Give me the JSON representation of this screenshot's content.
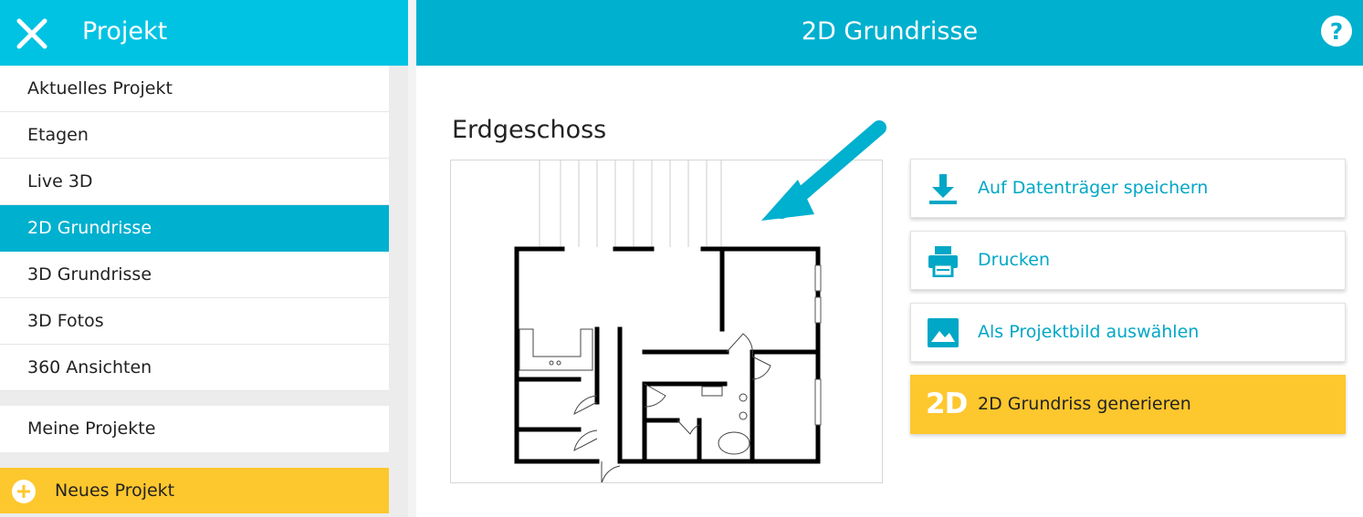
{
  "sidebar": {
    "title": "Projekt",
    "close_icon": "close-icon",
    "items": [
      {
        "label": "Aktuelles Projekt",
        "active": false
      },
      {
        "label": "Etagen",
        "active": false
      },
      {
        "label": "Live 3D",
        "active": false
      },
      {
        "label": "2D Grundrisse",
        "active": true
      },
      {
        "label": "3D Grundrisse",
        "active": false
      },
      {
        "label": "3D Fotos",
        "active": false
      },
      {
        "label": "360 Ansichten",
        "active": false
      }
    ],
    "my_projects": "Meine Projekte",
    "new_project": "Neues Projekt"
  },
  "header": {
    "title": "2D Grundrisse",
    "help_icon": "help-icon"
  },
  "main": {
    "floor_title": "Erdgeschoss",
    "actions": [
      {
        "label": "Auf Datenträger speichern",
        "icon": "download-icon"
      },
      {
        "label": "Drucken",
        "icon": "printer-icon"
      },
      {
        "label": "Als Projektbild auswählen",
        "icon": "image-icon"
      },
      {
        "label": "2D Grundriss generieren",
        "icon": "2d-icon",
        "badge": "2D"
      }
    ]
  },
  "colors": {
    "sidebar_header": "#00c3e3",
    "main_header": "#00b0cf",
    "active_item": "#00b0cf",
    "accent_yellow": "#fdc72e",
    "action_text": "#00a7c6"
  }
}
